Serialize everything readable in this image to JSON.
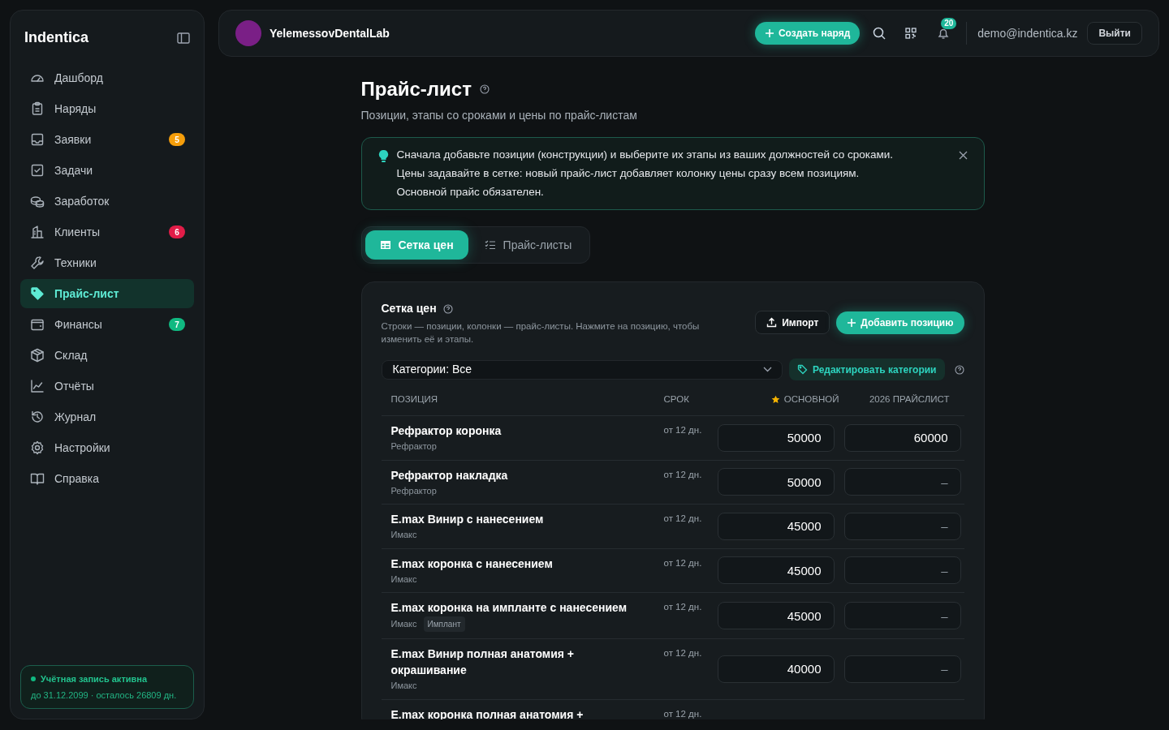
{
  "sidebar": {
    "logo": "Indentica",
    "items": [
      {
        "label": "Дашборд",
        "selected": false
      },
      {
        "label": "Наряды",
        "selected": false
      },
      {
        "label": "Заявки",
        "selected": false,
        "badge": "5",
        "color": "#f59e0b"
      },
      {
        "label": "Задачи",
        "selected": false
      },
      {
        "label": "Заработок",
        "selected": false
      },
      {
        "label": "Клиенты",
        "selected": false,
        "badge": "6",
        "color": "#e11d48"
      },
      {
        "label": "Техники",
        "selected": false
      },
      {
        "label": "Прайс-лист",
        "selected": true
      },
      {
        "label": "Финансы",
        "selected": false,
        "badge": "7",
        "color": "#10b981"
      },
      {
        "label": "Склад",
        "selected": false
      },
      {
        "label": "Отчёты",
        "selected": false
      },
      {
        "label": "Журнал",
        "selected": false
      },
      {
        "label": "Настройки",
        "selected": false
      },
      {
        "label": "Справка",
        "selected": false
      }
    ],
    "account": {
      "status": "Учётная запись активна",
      "detail": "до 31.12.2099 · осталось 26809 дн."
    }
  },
  "topbar": {
    "org": "YelemessovDentalLab",
    "create_button": "Создать наряд",
    "notifications": "20",
    "email": "demo@indentica.kz",
    "logout": "Выйти"
  },
  "page": {
    "title": "Прайс-лист",
    "subtitle": "Позиции, этапы со сроками и цены по прайс-листам",
    "notice": [
      "Сначала добавьте позиции (конструкции) и выберите их этапы из ваших должностей со сроками.",
      "Цены задавайте в сетке: новый прайс-лист добавляет колонку цены сразу всем позициям.",
      "Основной прайс обязателен."
    ],
    "tabs": [
      {
        "label": "Сетка цен",
        "selected": true
      },
      {
        "label": "Прайс-листы",
        "selected": false
      }
    ]
  },
  "grid": {
    "title": "Сетка цен",
    "description": "Строки — позиции, колонки — прайс-листы. Нажмите на позицию, чтобы изменить её и этапы.",
    "import_button": "Импорт",
    "add_button": "Добавить позицию",
    "category_select": "Категории: Все",
    "edit_categories": "Редактировать категории",
    "columns": [
      {
        "label": "ПОЗИЦИЯ",
        "starred": false
      },
      {
        "label": "СРОК",
        "starred": false
      },
      {
        "label": "ОСНОВНОЙ",
        "starred": true
      },
      {
        "label": "2026 ПРАЙСЛИСТ",
        "starred": false
      }
    ],
    "rows": [
      {
        "name": "Рефрактор коронка",
        "category": "Рефрактор",
        "term": "от 12 дн.",
        "prices": [
          {
            "value": "50000"
          },
          {
            "value": "60000"
          }
        ]
      },
      {
        "name": "Рефрактор накладка",
        "category": "Рефрактор",
        "term": "от 12 дн.",
        "prices": [
          {
            "value": "50000"
          },
          {
            "placeholder": "–"
          }
        ]
      },
      {
        "name": "E.max Винир с нанесением",
        "category": "Имакс",
        "term": "от 12 дн.",
        "prices": [
          {
            "value": "45000"
          },
          {
            "placeholder": "–"
          }
        ]
      },
      {
        "name": "E.max коронка с нанесением",
        "category": "Имакс",
        "term": "от 12 дн.",
        "prices": [
          {
            "value": "45000"
          },
          {
            "placeholder": "–"
          }
        ]
      },
      {
        "name": "E.max коронка на импланте с нанесением",
        "category": "Имакс",
        "tag": "Имплант",
        "term": "от 12 дн.",
        "prices": [
          {
            "value": "45000"
          },
          {
            "placeholder": "–"
          }
        ]
      },
      {
        "name": "E.max Винир полная анатомия + окрашивание",
        "category": "Имакс",
        "term": "от 12 дн.",
        "prices": [
          {
            "value": "40000"
          },
          {
            "placeholder": "–"
          }
        ]
      },
      {
        "name": "E.max коронка полная анатомия +",
        "term": "от 12 дн."
      }
    ]
  }
}
